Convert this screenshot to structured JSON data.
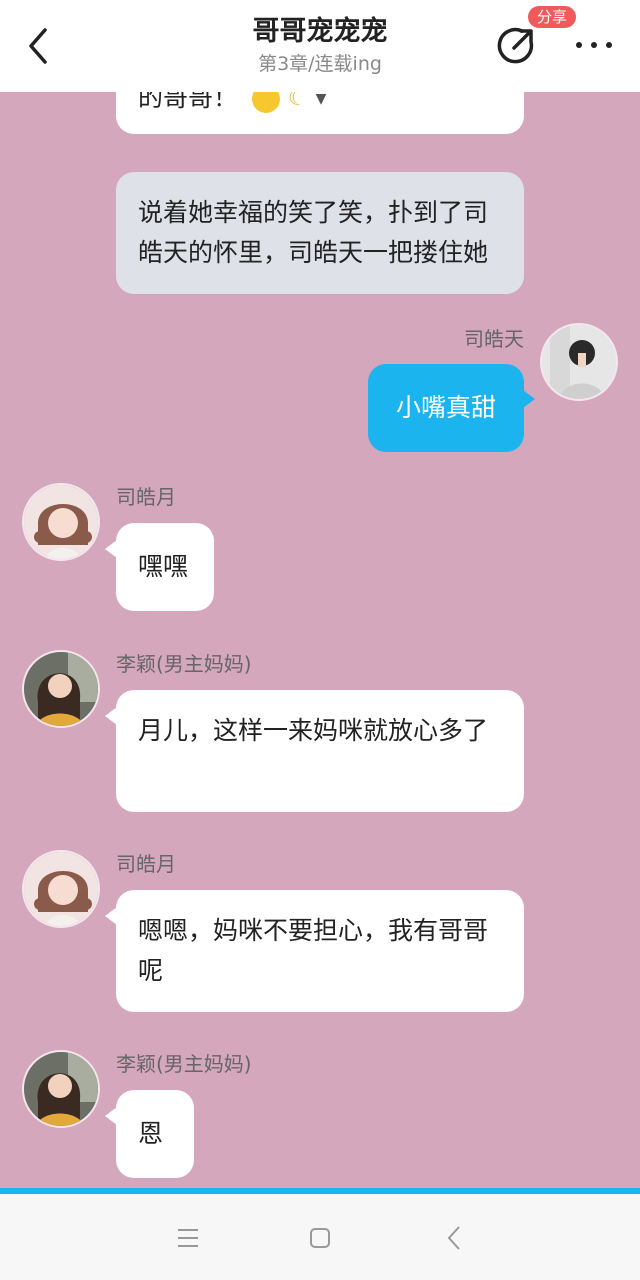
{
  "header": {
    "title": "哥哥宠宠宠",
    "subtitle": "第3章/连载ing",
    "share_badge": "分享"
  },
  "messages": [
    {
      "type": "narration",
      "text": "的哥哥！",
      "partial": true
    },
    {
      "type": "narration",
      "text": "说着她幸福的笑了笑，扑到了司皓天的怀里，司皓天一把搂住她"
    },
    {
      "type": "outgoing",
      "sender": "司皓天",
      "text": "小嘴真甜"
    },
    {
      "type": "incoming",
      "sender": "司皓月",
      "text": "嘿嘿"
    },
    {
      "type": "incoming",
      "sender": "李颖(男主妈妈)",
      "text": "月儿，这样一来妈咪就放心多了"
    },
    {
      "type": "incoming",
      "sender": "司皓月",
      "text": "嗯嗯，妈咪不要担心，我有哥哥呢"
    },
    {
      "type": "incoming",
      "sender": "李颖(男主妈妈)",
      "text": "恩"
    }
  ],
  "icons": {
    "back": "chevron-left-icon",
    "share": "share-arrow-icon",
    "more": "more-dots-icon",
    "nav_menu": "menu-lines-icon",
    "nav_home": "square-home-icon",
    "nav_back": "chevron-back-icon"
  },
  "colors": {
    "background": "#d4a7bd",
    "outgoing_bubble": "#1bb4ee",
    "narration_bubble": "#dfe1e9",
    "badge": "#f05a5a"
  }
}
